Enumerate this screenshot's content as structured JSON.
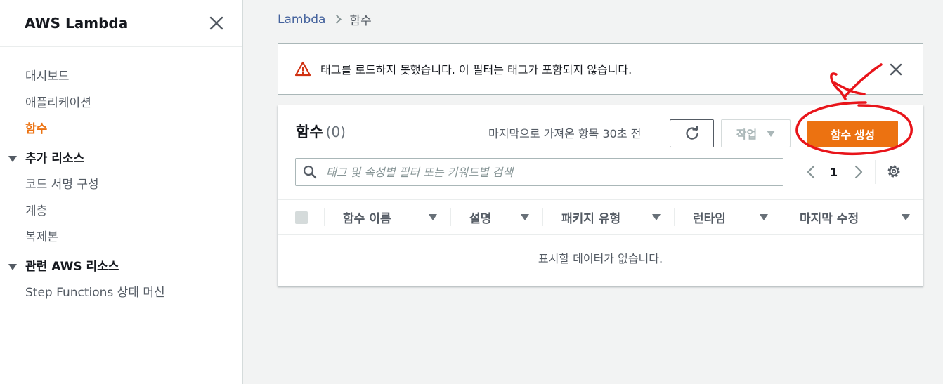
{
  "sidebar": {
    "title": "AWS Lambda",
    "items": [
      {
        "label": "대시보드"
      },
      {
        "label": "애플리케이션"
      },
      {
        "label": "함수"
      }
    ],
    "sections": [
      {
        "label": "추가 리소스",
        "items": [
          {
            "label": "코드 서명 구성"
          },
          {
            "label": "계층"
          },
          {
            "label": "복제본"
          }
        ]
      },
      {
        "label": "관련 AWS 리소스",
        "items": [
          {
            "label": "Step Functions 상태 머신"
          }
        ]
      }
    ]
  },
  "breadcrumb": {
    "root": "Lambda",
    "current": "함수"
  },
  "alert": {
    "message": "태그를 로드하지 못했습니다. 이 필터는 태그가 포함되지 않습니다."
  },
  "panel": {
    "title": "함수",
    "count": "(0)",
    "last_fetched": "마지막으로 가져온 항목 30초 전",
    "actions_label": "작업",
    "create_label": "함수 생성",
    "search_placeholder": "태그 및 속성별 필터 또는 키워드별 검색",
    "search_value": "",
    "page": "1",
    "columns": [
      {
        "label": "함수 이름"
      },
      {
        "label": "설명"
      },
      {
        "label": "패키지 유형"
      },
      {
        "label": "런타임"
      },
      {
        "label": "마지막 수정"
      }
    ],
    "empty_message": "표시할 데이터가 없습니다."
  },
  "colors": {
    "accent": "#ec7211",
    "warning": "#d13212",
    "link": "#44629d",
    "annotation": "#e8141a"
  },
  "icons": [
    "close-icon",
    "warning-icon",
    "refresh-icon",
    "caret-down-icon",
    "search-icon",
    "chevron-left-icon",
    "chevron-right-icon",
    "settings-icon"
  ]
}
